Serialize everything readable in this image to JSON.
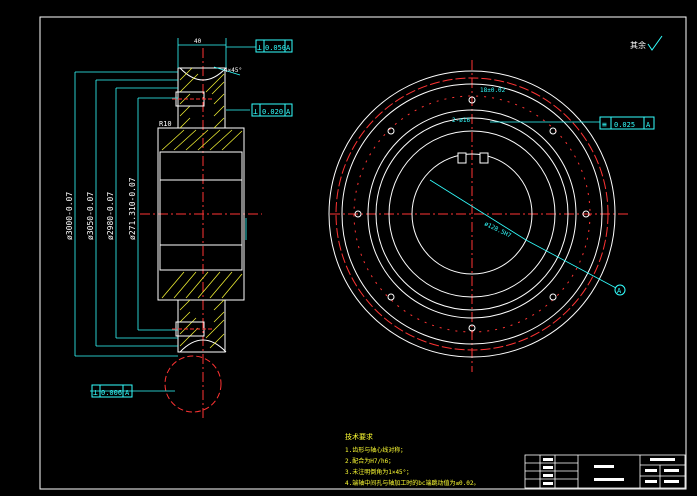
{
  "drawing": {
    "roughness_symbol_label": "其余",
    "tolerance_frames": [
      {
        "symbol": "⊥",
        "value": "0.050",
        "datum": "A"
      },
      {
        "symbol": "⊥",
        "value": "0.020",
        "datum": "A"
      },
      {
        "symbol": "⊥",
        "value": "0.006",
        "datum": "A"
      },
      {
        "symbol": "≡",
        "value": "0.025",
        "datum": "A"
      }
    ],
    "datum_label": "A",
    "dimensions": {
      "d_outer": "ø3000-0.07",
      "d_305": "ø3050-0.07",
      "d_298": "ø2980-0.07",
      "d_271": "ø271.310-0.07",
      "r_small": "R10",
      "top_width": "40",
      "slot": "4×45°",
      "front_keyway": "18±0.02",
      "front_bore": "ø128.5H7",
      "holes": "2-ø16"
    },
    "notes": {
      "title": "技术要求",
      "items": [
        "1.齿形与轴心线对称；",
        "2.配合为H7/h6；",
        "3.未注明倒角为1×45°；",
        "4.端轴中间孔与轴加工时的bc端跳动值为≤0.02。"
      ]
    }
  }
}
